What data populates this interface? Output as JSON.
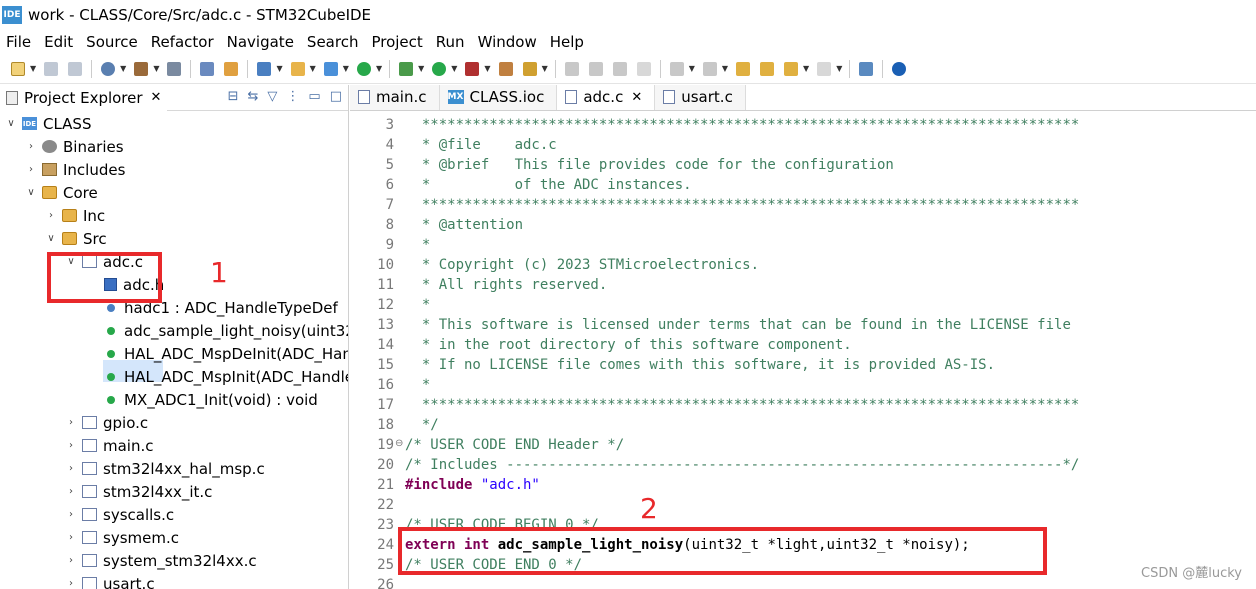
{
  "window": {
    "title": "work - CLASS/Core/Src/adc.c - STM32CubeIDE",
    "app_icon_text": "IDE"
  },
  "menu": [
    "File",
    "Edit",
    "Source",
    "Refactor",
    "Navigate",
    "Search",
    "Project",
    "Run",
    "Window",
    "Help"
  ],
  "left_panel": {
    "tab_label": "Project Explorer",
    "tree": [
      {
        "label": "CLASS",
        "icon": "project-icon"
      },
      {
        "label": "Binaries",
        "icon": "binaries-icon"
      },
      {
        "label": "Includes",
        "icon": "includes-icon"
      },
      {
        "label": "Core",
        "icon": "folder-icon"
      },
      {
        "label": "Inc",
        "icon": "folder-icon"
      },
      {
        "label": "Src",
        "icon": "folder-icon"
      },
      {
        "label": "adc.c",
        "icon": "c-file-icon"
      },
      {
        "label": "adc.h",
        "icon": "h-file-icon"
      },
      {
        "label": "hadc1 : ADC_HandleTypeDef",
        "icon": "variable-icon"
      },
      {
        "label": "adc_sample_light_noisy(uint32_",
        "icon": "function-icon"
      },
      {
        "label": "HAL_ADC_MspDeInit(ADC_Han",
        "icon": "function-icon"
      },
      {
        "label": "HAL_ADC_MspInit(ADC_Handle",
        "icon": "function-icon"
      },
      {
        "label": "MX_ADC1_Init(void) : void",
        "icon": "function-icon"
      },
      {
        "label": "gpio.c",
        "icon": "c-file-icon"
      },
      {
        "label": "main.c",
        "icon": "c-file-icon"
      },
      {
        "label": "stm32l4xx_hal_msp.c",
        "icon": "c-file-icon"
      },
      {
        "label": "stm32l4xx_it.c",
        "icon": "c-file-icon"
      },
      {
        "label": "syscalls.c",
        "icon": "c-file-icon"
      },
      {
        "label": "sysmem.c",
        "icon": "c-file-icon"
      },
      {
        "label": "system_stm32l4xx.c",
        "icon": "c-file-icon"
      },
      {
        "label": "usart.c",
        "icon": "c-file-icon"
      }
    ]
  },
  "editor": {
    "tabs": [
      {
        "label": "main.c",
        "icon": "c-file-icon"
      },
      {
        "label": "CLASS.ioc",
        "icon": "mx-icon",
        "icon_text": "MX"
      },
      {
        "label": "adc.c",
        "icon": "c-file-icon",
        "active": true
      },
      {
        "label": "usart.c",
        "icon": "c-file-icon"
      }
    ],
    "lines": [
      {
        "n": "3",
        "text": "  ******************************************************************************"
      },
      {
        "n": "4",
        "text": "  * @file    adc.c"
      },
      {
        "n": "5",
        "text": "  * @brief   This file provides code for the configuration"
      },
      {
        "n": "6",
        "text": "  *          of the ADC instances."
      },
      {
        "n": "7",
        "text": "  ******************************************************************************"
      },
      {
        "n": "8",
        "text": "  * @attention"
      },
      {
        "n": "9",
        "text": "  *"
      },
      {
        "n": "10",
        "text": "  * Copyright (c) 2023 STMicroelectronics."
      },
      {
        "n": "11",
        "text": "  * All rights reserved."
      },
      {
        "n": "12",
        "text": "  *"
      },
      {
        "n": "13",
        "text": "  * This software is licensed under terms that can be found in the LICENSE file"
      },
      {
        "n": "14",
        "text": "  * in the root directory of this software component."
      },
      {
        "n": "15",
        "text": "  * If no LICENSE file comes with this software, it is provided AS-IS."
      },
      {
        "n": "16",
        "text": "  *"
      },
      {
        "n": "17",
        "text": "  ******************************************************************************"
      },
      {
        "n": "18",
        "text": "  */"
      },
      {
        "n": "19",
        "text": "/* USER CODE END Header */"
      },
      {
        "n": "20",
        "text": "/* Includes ------------------------------------------------------------------*/"
      },
      {
        "n": "21",
        "kw": "#include ",
        "str": "\"adc.h\""
      },
      {
        "n": "22",
        "text": ""
      },
      {
        "n": "23",
        "text": "/* USER CODE BEGIN 0 */"
      },
      {
        "n": "24",
        "kw": "extern int ",
        "fn": "adc_sample_light_noisy",
        "rest": "(uint32_t *light,uint32_t *noisy);"
      },
      {
        "n": "25",
        "text": "/* USER CODE END 0 */"
      },
      {
        "n": "26",
        "text": ""
      }
    ]
  },
  "annotations": [
    {
      "label": "1"
    },
    {
      "label": "2"
    }
  ],
  "watermark": "CSDN @麓lucky",
  "colors": {
    "annotation": "#e8292b",
    "comment": "#3f7f5f",
    "keyword": "#7f0055",
    "string": "#2a00ff",
    "selection": "#d4e6fb"
  }
}
